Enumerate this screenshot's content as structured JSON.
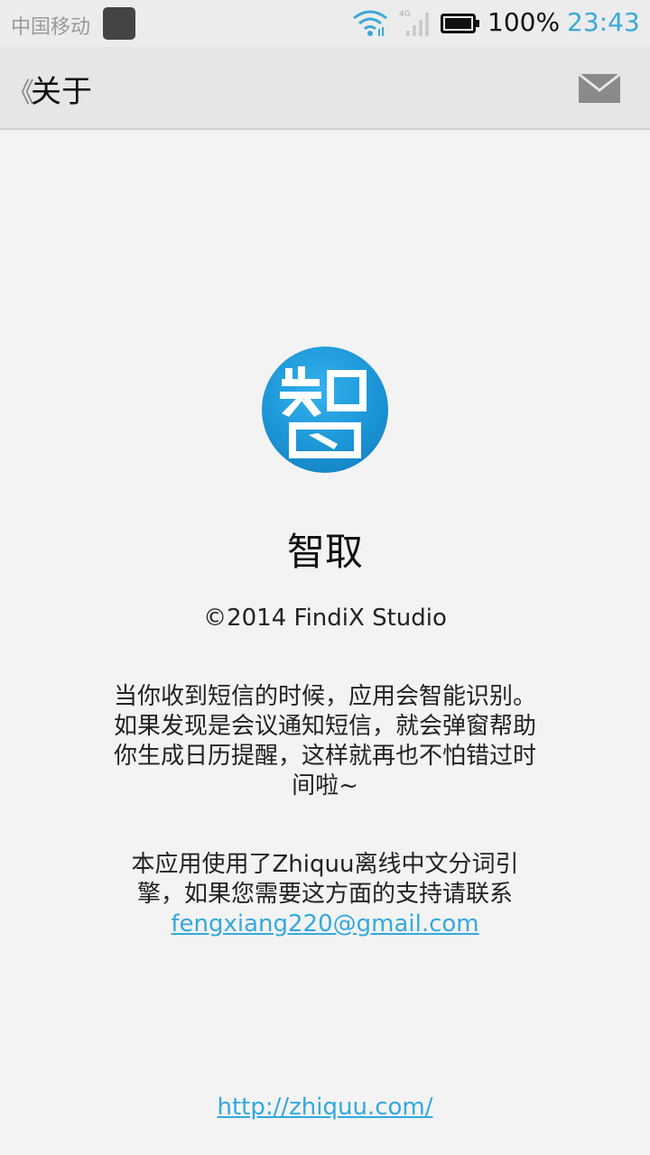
{
  "status_bar": {
    "carrier": "中国移动",
    "network_type": "4G",
    "battery": "100%",
    "time": "23:43",
    "icons": [
      "notification-icon",
      "wifi-icon",
      "signal-icon",
      "battery-icon"
    ]
  },
  "action_bar": {
    "title": "关于",
    "back_icon": "chevron-left-icon",
    "menu_icon": "mail-icon"
  },
  "about": {
    "logo_char": "智",
    "app_name": "智取",
    "copyright": "©2014 FindiX Studio",
    "description": "当你收到短信的时候，应用会智能识别。如果发现是会议通知短信，就会弹窗帮助你生成日历提醒，这样就再也不怕错过时间啦~",
    "engine_note": "本应用使用了Zhiquu离线中文分词引擎，如果您需要这方面的支持请联系",
    "email": "fengxiang220@gmail.com",
    "website": "http://zhiquu.com/"
  },
  "colors": {
    "accent": "#33a9dd",
    "logo_blue": "#1b95d6",
    "background": "#f3f3f3"
  }
}
